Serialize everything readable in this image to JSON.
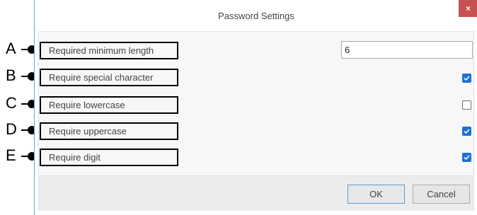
{
  "window": {
    "title": "Password Settings",
    "close_label": "×"
  },
  "settings": {
    "min_length": {
      "label": "Required minimum length",
      "value": "6"
    },
    "special": {
      "label": "Require special character",
      "checked": true
    },
    "lowercase": {
      "label": "Require lowercase",
      "checked": false
    },
    "uppercase": {
      "label": "Require uppercase",
      "checked": true
    },
    "digit": {
      "label": "Require digit",
      "checked": true
    }
  },
  "buttons": {
    "ok": "OK",
    "cancel": "Cancel"
  },
  "callouts": [
    "A",
    "B",
    "C",
    "D",
    "E"
  ],
  "colors": {
    "accent": "#1f6fd4",
    "close": "#c75050",
    "window_border": "#6e9fd1"
  }
}
